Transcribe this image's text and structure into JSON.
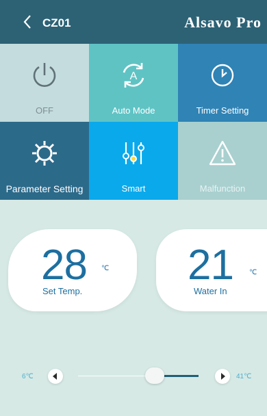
{
  "header": {
    "device_name": "CZ01",
    "brand": "Alsavo Pro"
  },
  "tiles": [
    {
      "label": "OFF",
      "icon": "power-icon"
    },
    {
      "label": "Auto Mode",
      "icon": "auto-mode-icon"
    },
    {
      "label": "Timer Setting",
      "icon": "clock-icon"
    },
    {
      "label": "Parameter Setting",
      "icon": "gear-icon"
    },
    {
      "label": "Smart",
      "icon": "sliders-icon"
    },
    {
      "label": "Malfunction",
      "icon": "warning-icon"
    }
  ],
  "set_temp": {
    "value": "28",
    "unit": "℃",
    "label": "Set Temp."
  },
  "water_in": {
    "value": "21",
    "unit": "℃",
    "label": "Water In"
  },
  "slider": {
    "min_label": "6℃",
    "max_label": "41℃"
  },
  "colors": {
    "header": "#2d6275",
    "accent": "#0aa9ec",
    "text_blue": "#1d6fa0"
  }
}
